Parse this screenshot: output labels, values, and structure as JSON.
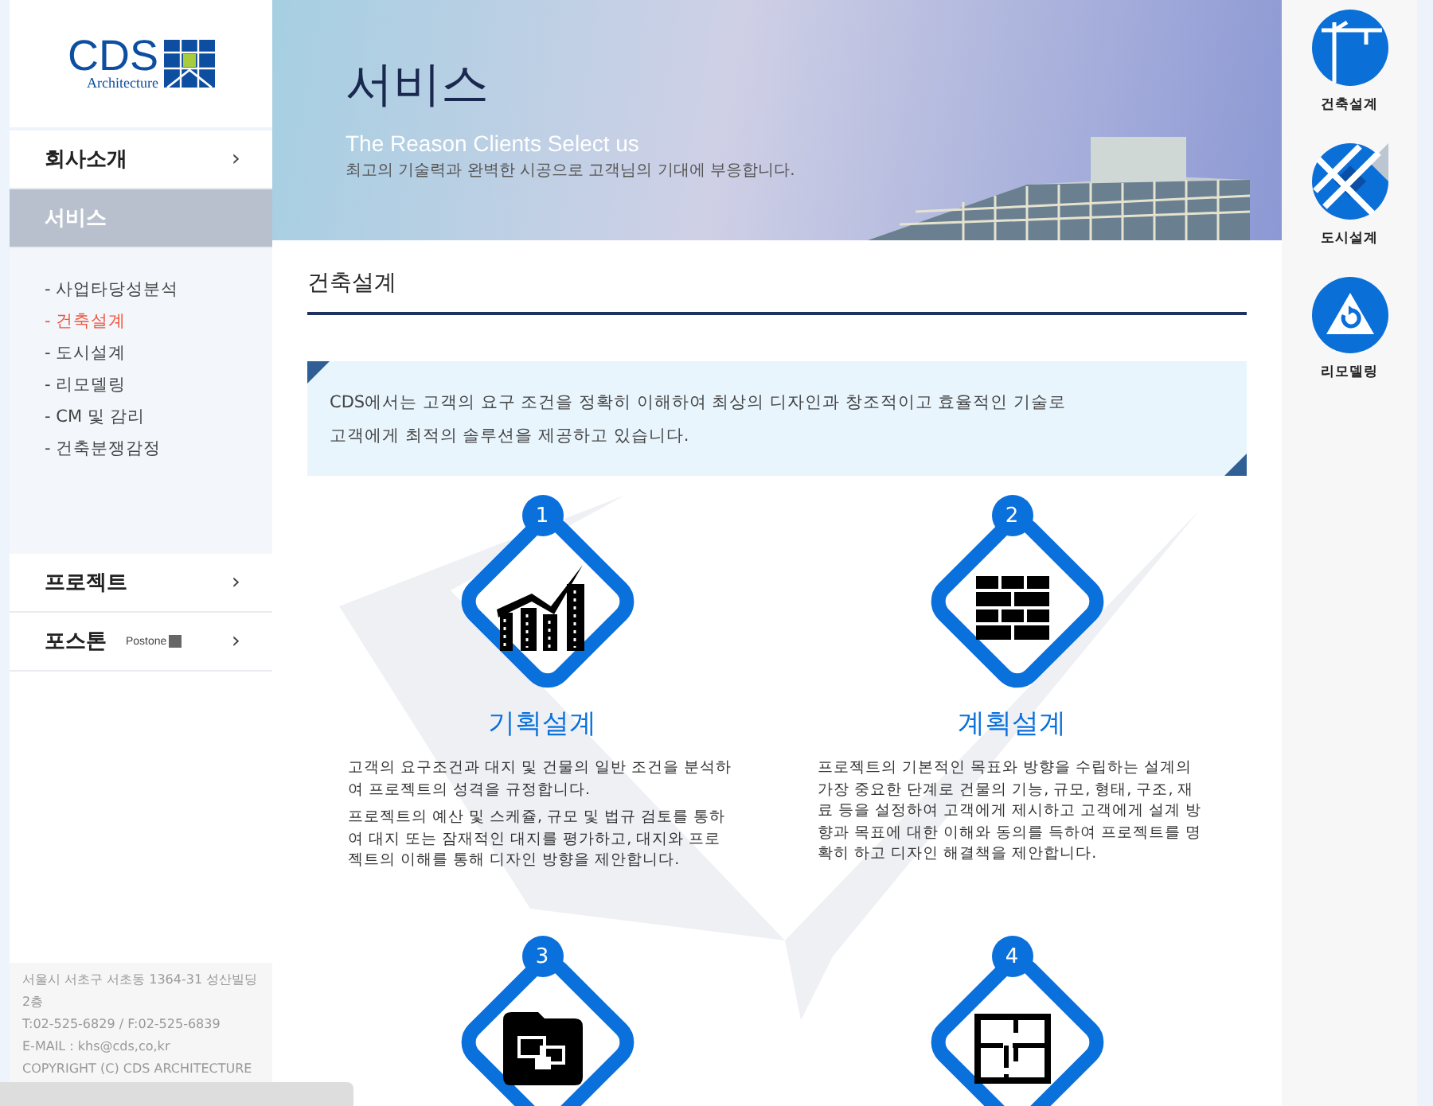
{
  "logo": {
    "text": "CDS",
    "subtext": "Architecture"
  },
  "nav": [
    {
      "label": "회사소개",
      "selected": false,
      "arrow": "›"
    },
    {
      "label": "서비스",
      "selected": true,
      "submenu": [
        {
          "label": "- 사업타당성분석",
          "selected": false
        },
        {
          "label": "- 건축설계",
          "selected": true
        },
        {
          "label": "- 도시설계",
          "selected": false
        },
        {
          "label": "- 리모델링",
          "selected": false
        },
        {
          "label": "- CM 및 감리",
          "selected": false
        },
        {
          "label": "- 건축분쟁감정",
          "selected": false
        }
      ]
    },
    {
      "label": "프로젝트",
      "selected": false,
      "arrow": "›"
    },
    {
      "label": "포스톤",
      "selected": false,
      "badge": "Postone",
      "arrow": "›"
    }
  ],
  "footer": [
    "서울시 서초구 서초동 1364-31 성산빌딩 2층",
    "T:02-525-6829 / F:02-525-6839",
    "E-MAIL : khs@cds,co,kr",
    "COPYRIGHT (C) CDS ARCHITECTURE"
  ],
  "banner": {
    "title": "서비스",
    "subtitle": "The Reason Clients Select us",
    "tagline": "최고의 기술력과 완벽한 시공으로 고객님의 기대에 부응합니다."
  },
  "section_title": "건축설계",
  "intro": [
    "CDS에서는 고객의 요구 조건을 정확히 이해하여 최상의 디자인과 창조적이고  효율적인 기술로",
    "고객에게 최적의 솔루션을  제공하고 있습니다."
  ],
  "steps": [
    {
      "number": "1",
      "kind": "chart",
      "title": "기획설계",
      "paragraphs": [
        "고객의 요구조건과 대지 및 건물의 일반 조건을 분석하여 프로젝트의 성격을 규정합니다.",
        "프로젝트의 예산 및 스케쥴,  규모 및 법규 검토를 통하여 대지 또는 잠재적인 대지를 평가하고, 대지와 프로젝트의 이해를 통해 디자인 방향을 제안합니다."
      ]
    },
    {
      "number": "2",
      "kind": "bricks",
      "title": "계획설계",
      "paragraphs": [
        "프로젝트의 기본적인 목표와 방향을 수립하는 설계의 가장 중요한 단계로 건물의 기능, 규모, 형태, 구조, 재료 등을 설정하여 고객에게 제시하고 고객에게 설계 방향과 목표에 대한 이해와 동의를 득하여 프로젝트를 명확히 하고 디자인 해결책을 제안합니다."
      ]
    },
    {
      "number": "3",
      "kind": "folder"
    },
    {
      "number": "4",
      "kind": "floorplan"
    }
  ],
  "quick_menu": [
    {
      "label": "건축설계",
      "kind": "crane"
    },
    {
      "label": "도시설계",
      "kind": "map"
    },
    {
      "label": "리모델링",
      "kind": "remodel"
    }
  ]
}
